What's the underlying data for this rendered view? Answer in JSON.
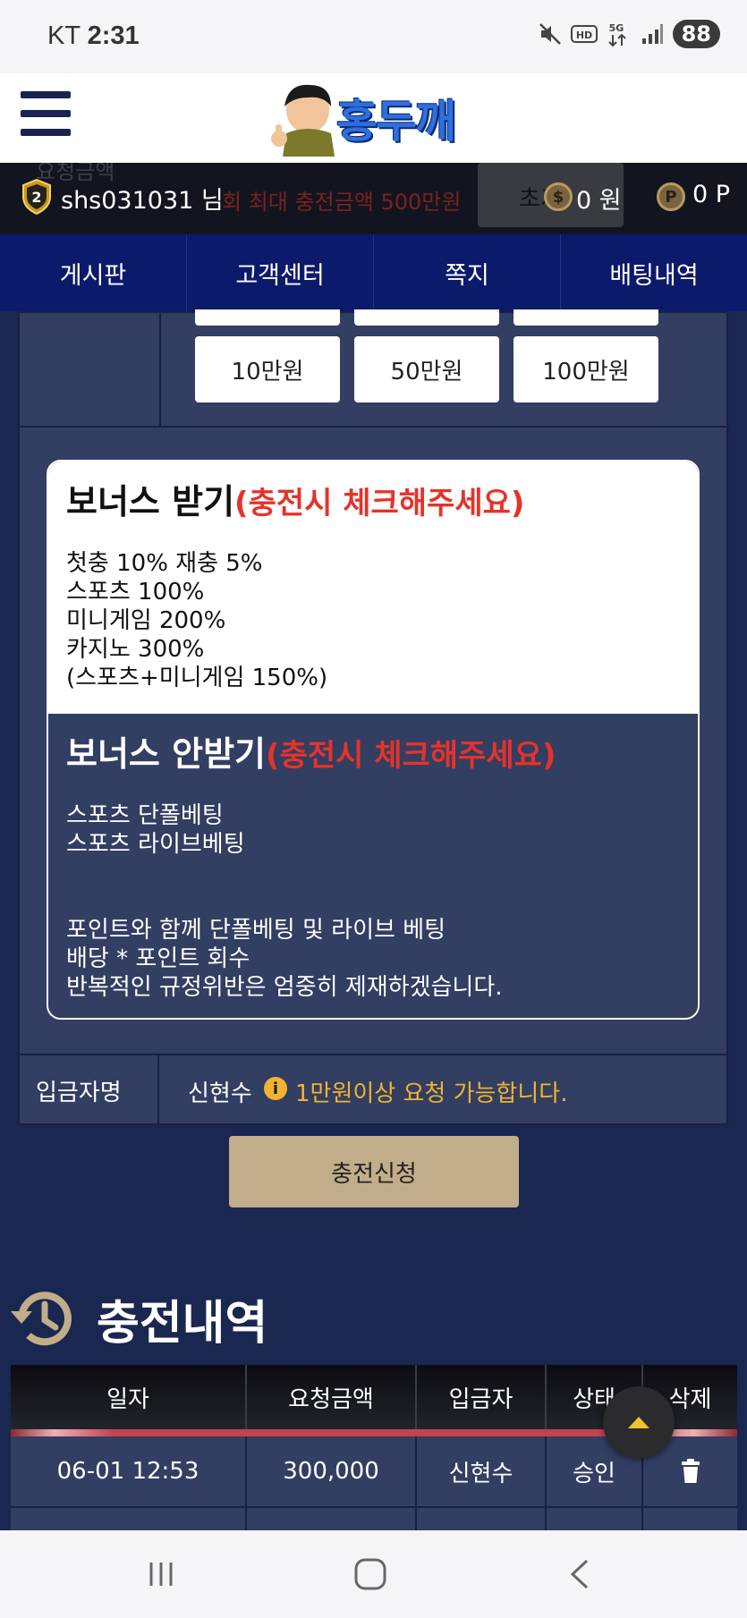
{
  "status_bar": {
    "carrier": "KT",
    "time": "2:31",
    "battery": "88"
  },
  "header": {
    "logo_text": "홍두깨"
  },
  "user_bar": {
    "username": "shs031031 님",
    "level": "2",
    "money": "0 원",
    "points": "0 P",
    "overlap_label": "요청금액",
    "overlap_notice": "회 최대 충전금액 500만원",
    "overlap_balance": "초기"
  },
  "nav": {
    "tabs": [
      "게시판",
      "고객센터",
      "쪽지",
      "배팅내역"
    ]
  },
  "amount_buttons": [
    "10만원",
    "50만원",
    "100만원"
  ],
  "bonus_receive": {
    "title": "보너스 받기",
    "note": "(충전시 체크해주세요)",
    "lines": [
      "첫충 10% 재충 5%",
      "스포츠 100%",
      "미니게임 200%",
      "카지노 300%",
      "(스포츠+미니게임 150%)"
    ]
  },
  "bonus_none": {
    "title": "보너스 안받기",
    "note": "(충전시 체크해주세요)",
    "lines": [
      "스포츠 단폴베팅",
      "스포츠 라이브베팅"
    ],
    "warning": [
      "포인트와 함께 단폴베팅 및 라이브 베팅",
      "배당 * 포인트 회수",
      "반복적인 규정위반은 엄중히 제재하겠습니다."
    ]
  },
  "depositor": {
    "label": "입금자명",
    "name": "신현수",
    "note": "1만원이상 요청 가능합니다."
  },
  "submit_label": "충전신청",
  "history": {
    "title": "충전내역",
    "columns": [
      "일자",
      "요청금액",
      "입금자",
      "상태",
      "삭제"
    ],
    "rows": [
      {
        "date": "06-01 12:53",
        "amount": "300,000",
        "depositor": "신현수",
        "status": "승인"
      }
    ]
  },
  "icons": {
    "menu": "hamburger-icon",
    "level": "level-badge-icon",
    "coin": "coin-icon",
    "point": "point-icon",
    "info": "info-icon",
    "history": "history-icon",
    "delete": "trash-icon",
    "scroll_top": "chevron-up-icon"
  },
  "colors": {
    "accent_red": "#e5332a",
    "info_yellow": "#f2b330",
    "nav_bg": "#0b1a6b",
    "submit_bg": "#c2ad8a"
  }
}
